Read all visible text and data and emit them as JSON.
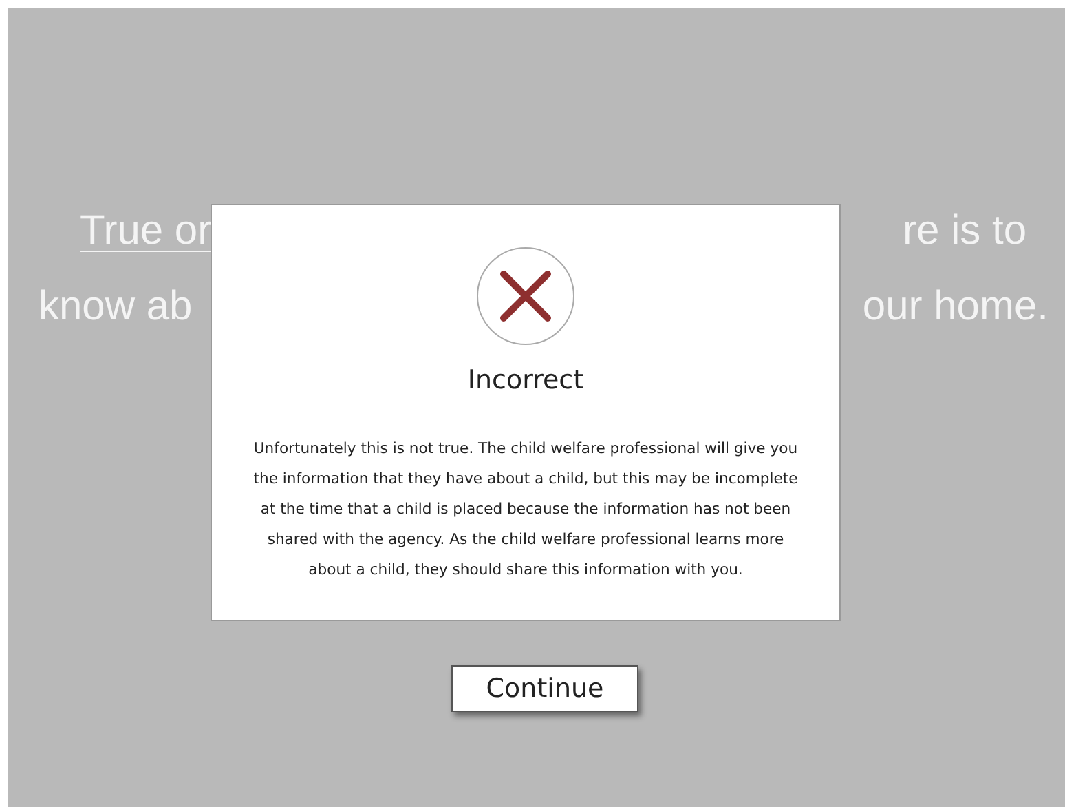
{
  "question": {
    "lines": [
      {
        "left": "True or",
        "left_underlined": true,
        "right": "re is to"
      },
      {
        "left": "know ab",
        "left_underlined": false,
        "right": "our home."
      }
    ]
  },
  "dialog": {
    "correct": false,
    "title": "Incorrect",
    "message": "Unfortunately this is not true. The child welfare professional will give you the information that they have about a child, but this may be incomplete at the time that a child is placed because the information has not been shared with the agency. As the child welfare professional learns more about a child, they should share this information with you."
  },
  "continue_button": {
    "label": "Continue"
  }
}
